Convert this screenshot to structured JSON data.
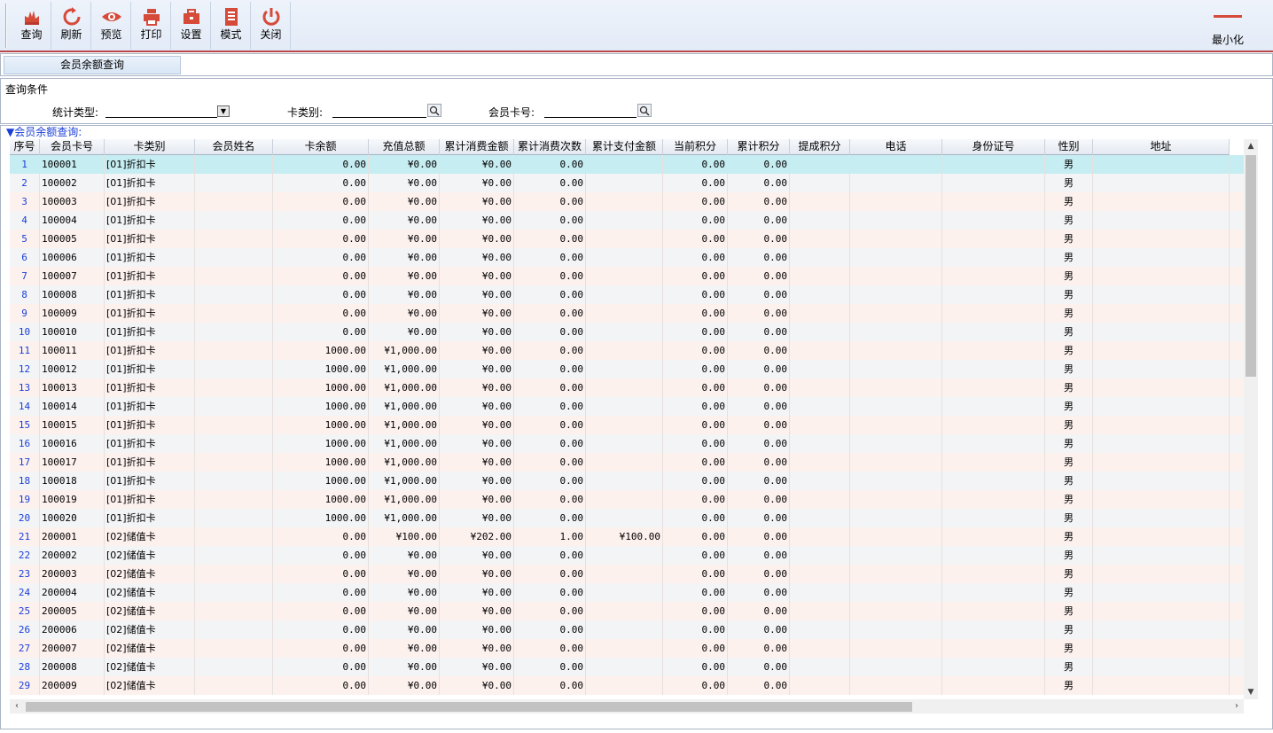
{
  "toolbar": {
    "buttons": [
      {
        "label": "查询",
        "icon": "hand-query-icon"
      },
      {
        "label": "刷新",
        "icon": "refresh-icon"
      },
      {
        "label": "预览",
        "icon": "eye-icon"
      },
      {
        "label": "打印",
        "icon": "printer-icon"
      },
      {
        "label": "设置",
        "icon": "toolbox-icon"
      },
      {
        "label": "模式",
        "icon": "document-icon"
      },
      {
        "label": "关闭",
        "icon": "power-icon"
      }
    ],
    "minimize_label": "最小化",
    "accent_color": "#d64a3a"
  },
  "tab": {
    "label": "会员余额查询"
  },
  "query": {
    "title": "查询条件",
    "stat_type_label": "统计类型:",
    "stat_type_value": "",
    "card_type_label": "卡类别:",
    "card_type_value": "",
    "card_no_label": "会员卡号:",
    "card_no_value": ""
  },
  "grid": {
    "caption": "▼会员余额查询:",
    "columns": [
      "序号",
      "会员卡号",
      "卡类别",
      "会员姓名",
      "卡余额",
      "充值总额",
      "累计消费金额",
      "累计消费次数",
      "累计支付金额",
      "当前积分",
      "累计积分",
      "提成积分",
      "电话",
      "身份证号",
      "性别",
      "地址"
    ],
    "rows": [
      [
        "1",
        "100001",
        "[01]折扣卡",
        "",
        "0.00",
        "¥0.00",
        "¥0.00",
        "0.00",
        "",
        "0.00",
        "0.00",
        "",
        "",
        "",
        "男",
        ""
      ],
      [
        "2",
        "100002",
        "[01]折扣卡",
        "",
        "0.00",
        "¥0.00",
        "¥0.00",
        "0.00",
        "",
        "0.00",
        "0.00",
        "",
        "",
        "",
        "男",
        ""
      ],
      [
        "3",
        "100003",
        "[01]折扣卡",
        "",
        "0.00",
        "¥0.00",
        "¥0.00",
        "0.00",
        "",
        "0.00",
        "0.00",
        "",
        "",
        "",
        "男",
        ""
      ],
      [
        "4",
        "100004",
        "[01]折扣卡",
        "",
        "0.00",
        "¥0.00",
        "¥0.00",
        "0.00",
        "",
        "0.00",
        "0.00",
        "",
        "",
        "",
        "男",
        ""
      ],
      [
        "5",
        "100005",
        "[01]折扣卡",
        "",
        "0.00",
        "¥0.00",
        "¥0.00",
        "0.00",
        "",
        "0.00",
        "0.00",
        "",
        "",
        "",
        "男",
        ""
      ],
      [
        "6",
        "100006",
        "[01]折扣卡",
        "",
        "0.00",
        "¥0.00",
        "¥0.00",
        "0.00",
        "",
        "0.00",
        "0.00",
        "",
        "",
        "",
        "男",
        ""
      ],
      [
        "7",
        "100007",
        "[01]折扣卡",
        "",
        "0.00",
        "¥0.00",
        "¥0.00",
        "0.00",
        "",
        "0.00",
        "0.00",
        "",
        "",
        "",
        "男",
        ""
      ],
      [
        "8",
        "100008",
        "[01]折扣卡",
        "",
        "0.00",
        "¥0.00",
        "¥0.00",
        "0.00",
        "",
        "0.00",
        "0.00",
        "",
        "",
        "",
        "男",
        ""
      ],
      [
        "9",
        "100009",
        "[01]折扣卡",
        "",
        "0.00",
        "¥0.00",
        "¥0.00",
        "0.00",
        "",
        "0.00",
        "0.00",
        "",
        "",
        "",
        "男",
        ""
      ],
      [
        "10",
        "100010",
        "[01]折扣卡",
        "",
        "0.00",
        "¥0.00",
        "¥0.00",
        "0.00",
        "",
        "0.00",
        "0.00",
        "",
        "",
        "",
        "男",
        ""
      ],
      [
        "11",
        "100011",
        "[01]折扣卡",
        "",
        "1000.00",
        "¥1,000.00",
        "¥0.00",
        "0.00",
        "",
        "0.00",
        "0.00",
        "",
        "",
        "",
        "男",
        ""
      ],
      [
        "12",
        "100012",
        "[01]折扣卡",
        "",
        "1000.00",
        "¥1,000.00",
        "¥0.00",
        "0.00",
        "",
        "0.00",
        "0.00",
        "",
        "",
        "",
        "男",
        ""
      ],
      [
        "13",
        "100013",
        "[01]折扣卡",
        "",
        "1000.00",
        "¥1,000.00",
        "¥0.00",
        "0.00",
        "",
        "0.00",
        "0.00",
        "",
        "",
        "",
        "男",
        ""
      ],
      [
        "14",
        "100014",
        "[01]折扣卡",
        "",
        "1000.00",
        "¥1,000.00",
        "¥0.00",
        "0.00",
        "",
        "0.00",
        "0.00",
        "",
        "",
        "",
        "男",
        ""
      ],
      [
        "15",
        "100015",
        "[01]折扣卡",
        "",
        "1000.00",
        "¥1,000.00",
        "¥0.00",
        "0.00",
        "",
        "0.00",
        "0.00",
        "",
        "",
        "",
        "男",
        ""
      ],
      [
        "16",
        "100016",
        "[01]折扣卡",
        "",
        "1000.00",
        "¥1,000.00",
        "¥0.00",
        "0.00",
        "",
        "0.00",
        "0.00",
        "",
        "",
        "",
        "男",
        ""
      ],
      [
        "17",
        "100017",
        "[01]折扣卡",
        "",
        "1000.00",
        "¥1,000.00",
        "¥0.00",
        "0.00",
        "",
        "0.00",
        "0.00",
        "",
        "",
        "",
        "男",
        ""
      ],
      [
        "18",
        "100018",
        "[01]折扣卡",
        "",
        "1000.00",
        "¥1,000.00",
        "¥0.00",
        "0.00",
        "",
        "0.00",
        "0.00",
        "",
        "",
        "",
        "男",
        ""
      ],
      [
        "19",
        "100019",
        "[01]折扣卡",
        "",
        "1000.00",
        "¥1,000.00",
        "¥0.00",
        "0.00",
        "",
        "0.00",
        "0.00",
        "",
        "",
        "",
        "男",
        ""
      ],
      [
        "20",
        "100020",
        "[01]折扣卡",
        "",
        "1000.00",
        "¥1,000.00",
        "¥0.00",
        "0.00",
        "",
        "0.00",
        "0.00",
        "",
        "",
        "",
        "男",
        ""
      ],
      [
        "21",
        "200001",
        "[02]储值卡",
        "",
        "0.00",
        "¥100.00",
        "¥202.00",
        "1.00",
        "¥100.00",
        "0.00",
        "0.00",
        "",
        "",
        "",
        "男",
        ""
      ],
      [
        "22",
        "200002",
        "[02]储值卡",
        "",
        "0.00",
        "¥0.00",
        "¥0.00",
        "0.00",
        "",
        "0.00",
        "0.00",
        "",
        "",
        "",
        "男",
        ""
      ],
      [
        "23",
        "200003",
        "[02]储值卡",
        "",
        "0.00",
        "¥0.00",
        "¥0.00",
        "0.00",
        "",
        "0.00",
        "0.00",
        "",
        "",
        "",
        "男",
        ""
      ],
      [
        "24",
        "200004",
        "[02]储值卡",
        "",
        "0.00",
        "¥0.00",
        "¥0.00",
        "0.00",
        "",
        "0.00",
        "0.00",
        "",
        "",
        "",
        "男",
        ""
      ],
      [
        "25",
        "200005",
        "[02]储值卡",
        "",
        "0.00",
        "¥0.00",
        "¥0.00",
        "0.00",
        "",
        "0.00",
        "0.00",
        "",
        "",
        "",
        "男",
        ""
      ],
      [
        "26",
        "200006",
        "[02]储值卡",
        "",
        "0.00",
        "¥0.00",
        "¥0.00",
        "0.00",
        "",
        "0.00",
        "0.00",
        "",
        "",
        "",
        "男",
        ""
      ],
      [
        "27",
        "200007",
        "[02]储值卡",
        "",
        "0.00",
        "¥0.00",
        "¥0.00",
        "0.00",
        "",
        "0.00",
        "0.00",
        "",
        "",
        "",
        "男",
        ""
      ],
      [
        "28",
        "200008",
        "[02]储值卡",
        "",
        "0.00",
        "¥0.00",
        "¥0.00",
        "0.00",
        "",
        "0.00",
        "0.00",
        "",
        "",
        "",
        "男",
        ""
      ],
      [
        "29",
        "200009",
        "[02]储值卡",
        "",
        "0.00",
        "¥0.00",
        "¥0.00",
        "0.00",
        "",
        "0.00",
        "0.00",
        "",
        "",
        "",
        "男",
        ""
      ]
    ]
  }
}
